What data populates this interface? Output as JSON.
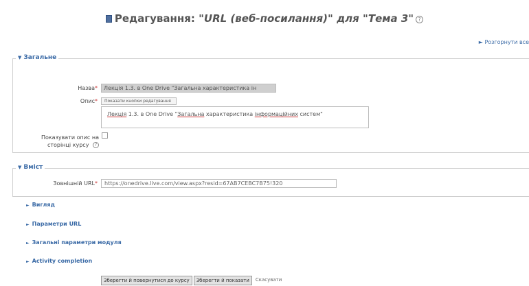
{
  "header": {
    "title_prefix": "Редагування: ",
    "title_main": "\"URL (веб-посилання)\" для \"Тема 3\"",
    "help_glyph": "?",
    "expand_all": "► Розгорнути все"
  },
  "general": {
    "legend": "Загальне",
    "name_label": "Назва",
    "name_value": "Лекція 1.3. в One Drive \"Загальна характеристика ін",
    "desc_label": "Опис",
    "toolbar_text": "Показати кнопки редагування",
    "description_parts": [
      "Лекція",
      " 1.3. в One Drive \"",
      "Загальна",
      " характеристика ",
      "інформаційних",
      " систем\""
    ],
    "show_desc_label_1": "Показувати опис на",
    "show_desc_label_2": "сторінці курсу"
  },
  "content": {
    "legend": "Вміст",
    "url_label": "Зовнішній URL",
    "url_value": "https://onedrive.live.com/view.aspx?resid=67AB7CEBC7B75!320"
  },
  "sections": [
    {
      "label": "Вигляд"
    },
    {
      "label": "Параметри URL"
    },
    {
      "label": "Загальні параметри модуля"
    },
    {
      "label": "Activity completion"
    }
  ],
  "buttons": {
    "save_return": "Зберегти й повернутися до курсу",
    "save_show": "Зберегти й показати",
    "cancel": "Скасувати"
  },
  "required_mark": "*",
  "colors": {
    "accent": "#3a6aa6",
    "required": "#cc3333"
  }
}
